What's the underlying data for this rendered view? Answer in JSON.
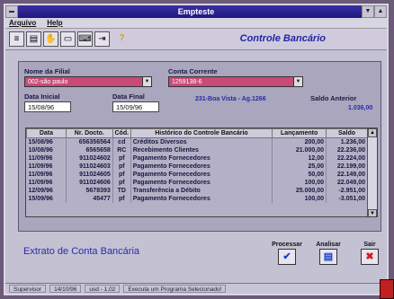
{
  "window": {
    "title": "Empteste"
  },
  "menu": [
    "Arquivo",
    "Help"
  ],
  "toolbar": {
    "heading": "Controle Bancário",
    "icons": [
      "list-icon",
      "report-icon",
      "hand-icon",
      "card-icon",
      "keyboard-icon",
      "exit-icon",
      "help-icon"
    ]
  },
  "filters": {
    "filial_label": "Nome da Filial",
    "filial_value": "002-são paulo",
    "conta_label": "Conta Corrente",
    "conta_value": "1259138-6",
    "data_inicial_label": "Data Inicial",
    "data_inicial_value": "15/08/96",
    "data_final_label": "Data Final",
    "data_final_value": "15/09/96",
    "agencia_text": "231-Boa Vista - Ag.1266",
    "saldo_anterior_label": "Saldo Anterior",
    "saldo_anterior_value": "1.036,00"
  },
  "grid": {
    "columns": [
      "Data",
      "Nr. Docto.",
      "Cód.",
      "Histórico do Controle Bancário",
      "Lançamento",
      "Saldo"
    ],
    "rows": [
      [
        "15/08/96",
        "656356564",
        "cd",
        "Créditos Diversos",
        "200,00",
        "1.236,00"
      ],
      [
        "10/08/96",
        "6565658",
        "RC",
        "Recebimento Clientes",
        "21.000,00",
        "22.236,00"
      ],
      [
        "11/09/96",
        "911024602",
        "pf",
        "Pagamento Fornecedores",
        "12,00",
        "22.224,00"
      ],
      [
        "11/09/96",
        "911024603",
        "pf",
        "Pagamento Fornecedores",
        "25,00",
        "22.199,00"
      ],
      [
        "11/09/96",
        "911024605",
        "pf",
        "Pagamento Fornecedores",
        "50,00",
        "22.149,00"
      ],
      [
        "11/09/96",
        "911024606",
        "pf",
        "Pagamento Fornecedores",
        "100,00",
        "22.049,00"
      ],
      [
        "12/09/96",
        "5678393",
        "TD",
        "Transferência a Débito",
        "25.000,00",
        "-2.951,00"
      ],
      [
        "15/09/96",
        "45477",
        "pf",
        "Pagamento Fornecedores",
        "100,00",
        "-3.051,00"
      ]
    ]
  },
  "footer": {
    "title": "Extrato de Conta Bancária",
    "processar": "Processar",
    "analisar": "Analisar",
    "sair": "Sair"
  },
  "status": [
    "Supervisor",
    "14/10/96",
    "usd - 1,02",
    "Executa um Programa Selecionado!"
  ]
}
